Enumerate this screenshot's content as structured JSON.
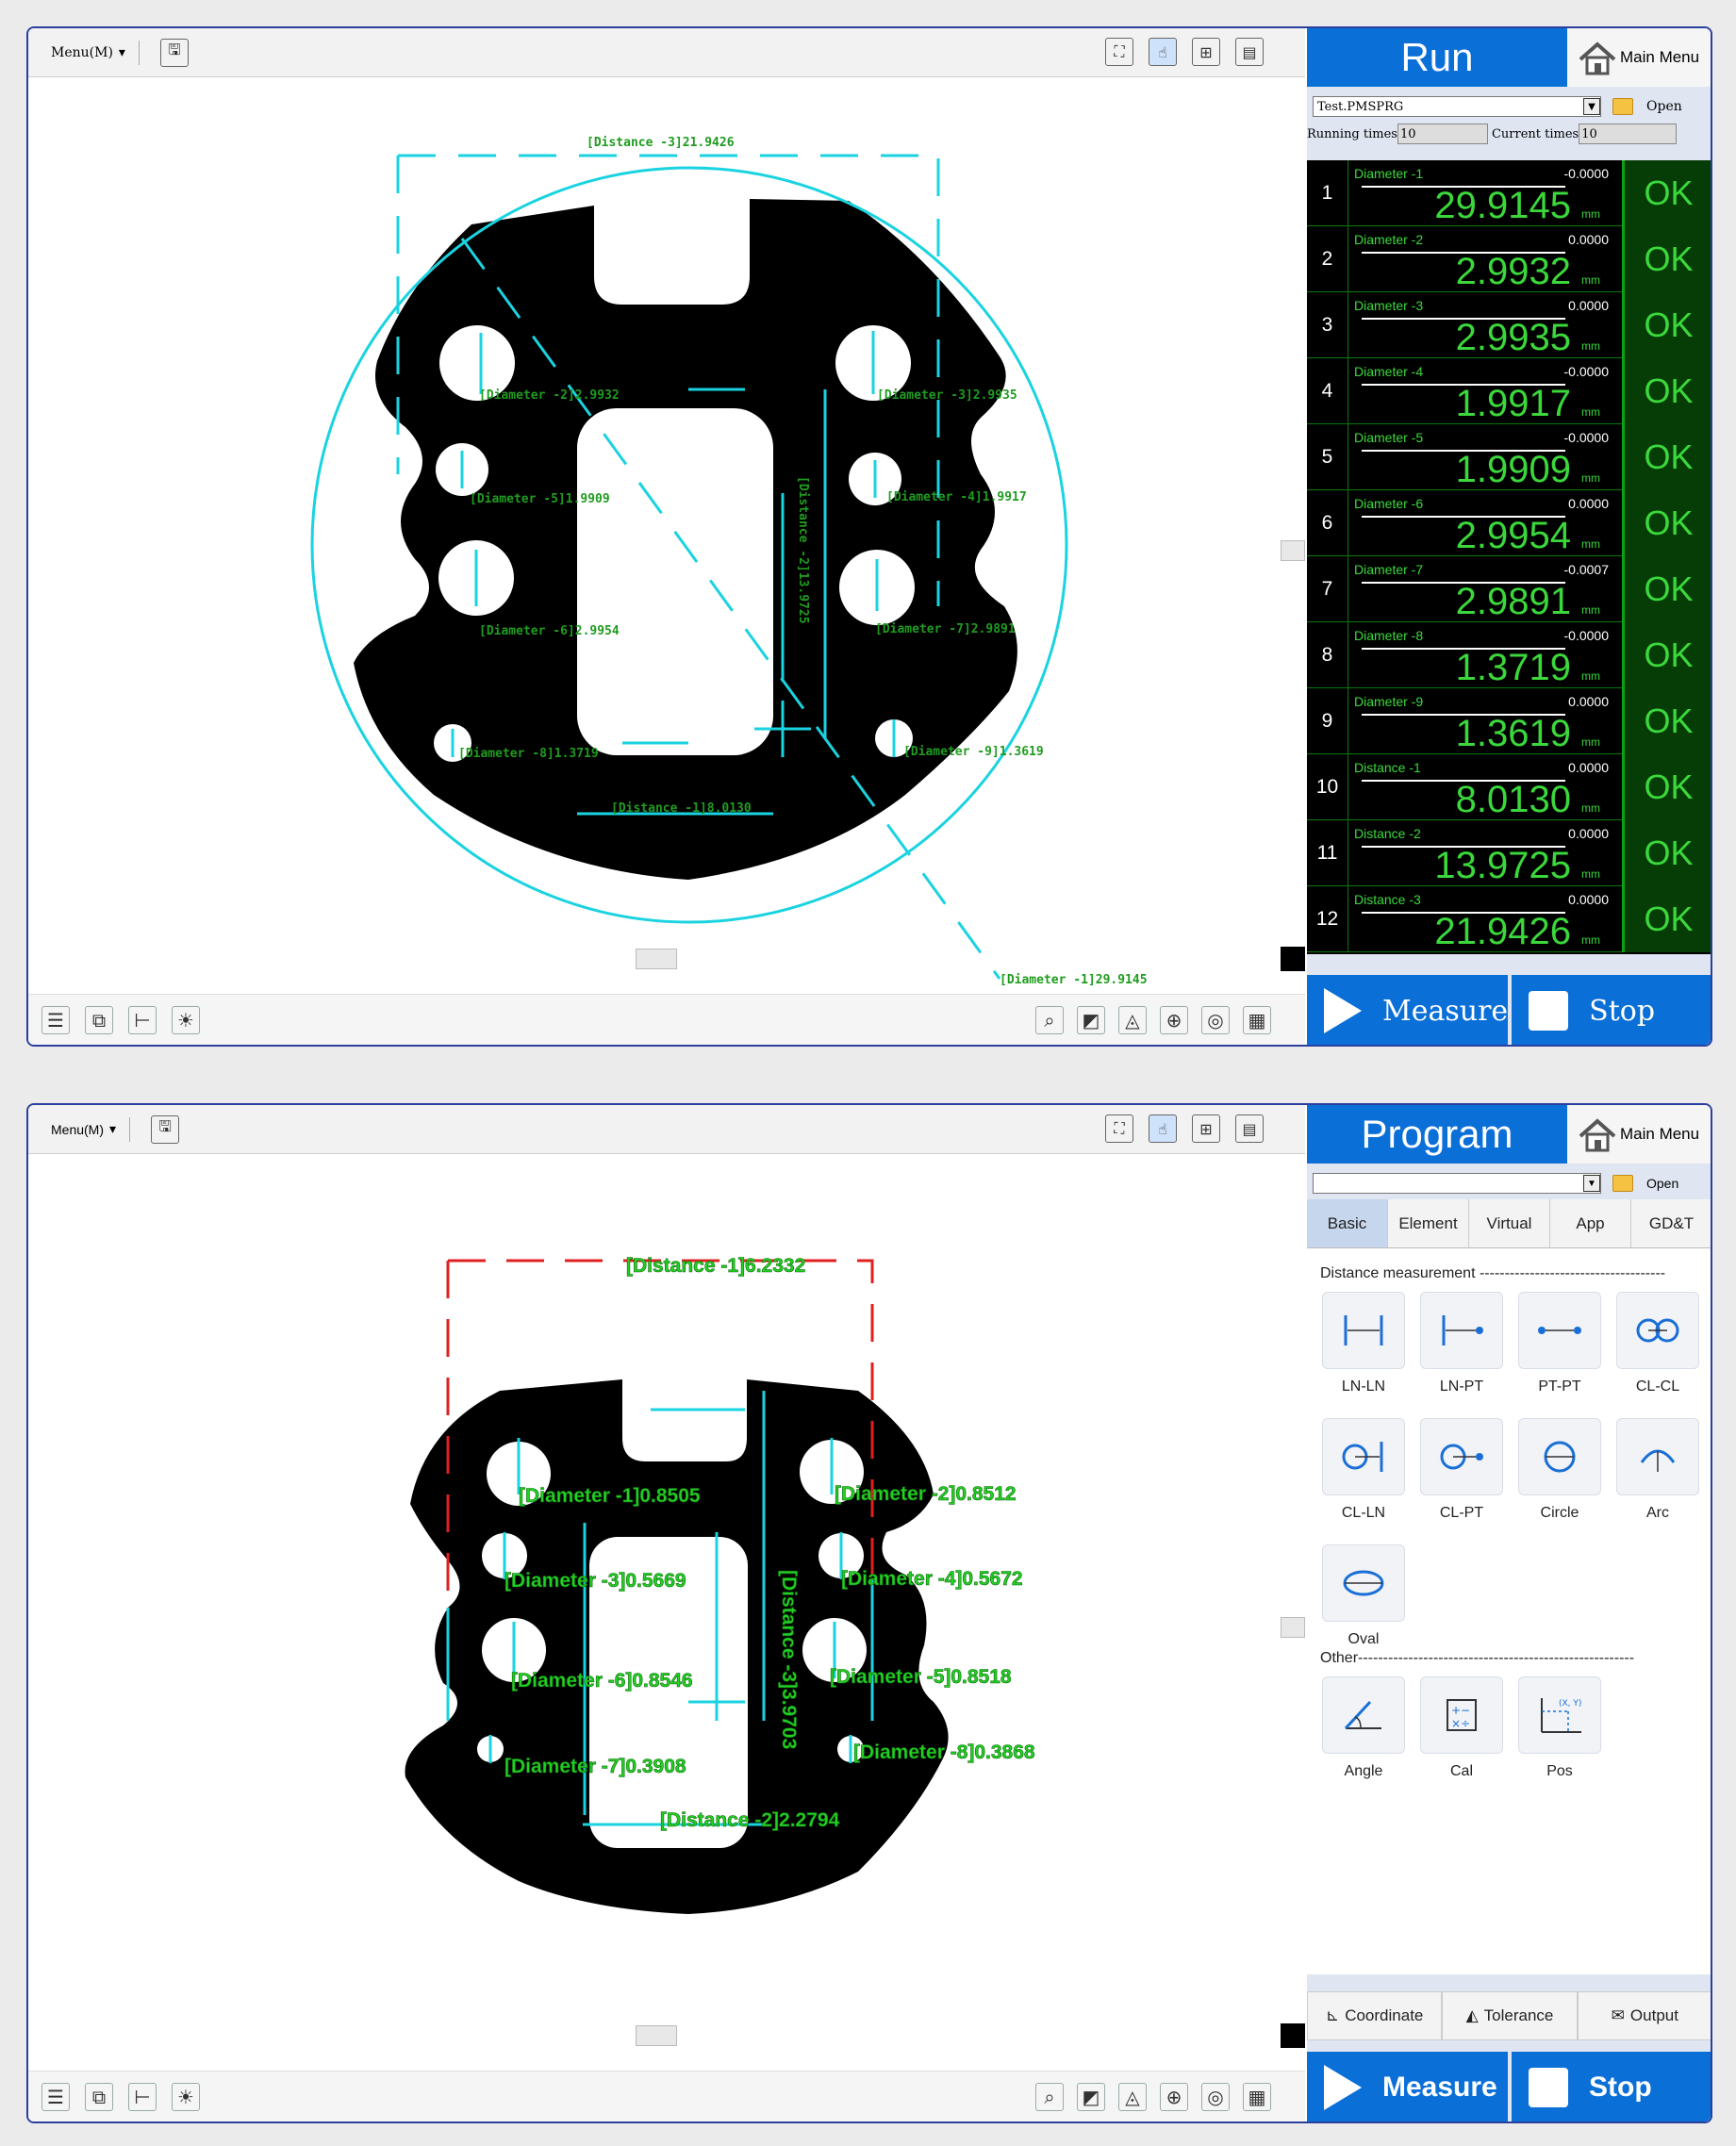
{
  "window1": {
    "menu_label": "Menu(M)",
    "panel_title": "Run",
    "main_menu": "Main Menu",
    "program_file": "Test.PMSPRG",
    "open_label": "Open",
    "running_times_label": "Running times",
    "running_times_value": "10",
    "current_times_label": "Current times",
    "current_times_value": "10",
    "results": [
      {
        "num": "1",
        "name": "Diameter -1",
        "dev": "-0.0000",
        "value": "29.9145",
        "unit": "mm",
        "status": "OK"
      },
      {
        "num": "2",
        "name": "Diameter -2",
        "dev": "0.0000",
        "value": "2.9932",
        "unit": "mm",
        "status": "OK"
      },
      {
        "num": "3",
        "name": "Diameter -3",
        "dev": "0.0000",
        "value": "2.9935",
        "unit": "mm",
        "status": "OK"
      },
      {
        "num": "4",
        "name": "Diameter -4",
        "dev": "-0.0000",
        "value": "1.9917",
        "unit": "mm",
        "status": "OK"
      },
      {
        "num": "5",
        "name": "Diameter -5",
        "dev": "-0.0000",
        "value": "1.9909",
        "unit": "mm",
        "status": "OK"
      },
      {
        "num": "6",
        "name": "Diameter -6",
        "dev": "0.0000",
        "value": "2.9954",
        "unit": "mm",
        "status": "OK"
      },
      {
        "num": "7",
        "name": "Diameter -7",
        "dev": "-0.0007",
        "value": "2.9891",
        "unit": "mm",
        "status": "OK"
      },
      {
        "num": "8",
        "name": "Diameter -8",
        "dev": "-0.0000",
        "value": "1.3719",
        "unit": "mm",
        "status": "OK"
      },
      {
        "num": "9",
        "name": "Diameter -9",
        "dev": "0.0000",
        "value": "1.3619",
        "unit": "mm",
        "status": "OK"
      },
      {
        "num": "10",
        "name": "Distance -1",
        "dev": "0.0000",
        "value": "8.0130",
        "unit": "mm",
        "status": "OK"
      },
      {
        "num": "11",
        "name": "Distance -2",
        "dev": "0.0000",
        "value": "13.9725",
        "unit": "mm",
        "status": "OK"
      },
      {
        "num": "12",
        "name": "Distance -3",
        "dev": "0.0000",
        "value": "21.9426",
        "unit": "mm",
        "status": "OK"
      }
    ],
    "measure_label": "Measure",
    "stop_label": "Stop",
    "annotations": {
      "a1": "[Distance -3]21.9426",
      "a2": "[Diameter -2]2.9932",
      "a3": "[Diameter -3]2.9935",
      "a4": "[Diameter -5]1.9909",
      "a5": "[Diameter -4]1.9917",
      "a6": "[Diameter -6]2.9954",
      "a7": "[Diameter -7]2.9891",
      "a8": "[Diameter -8]1.3719",
      "a9": "[Diameter -9]1.3619",
      "a10": "[Distance -1]8.0130",
      "a11": "[Distance -2]13.9725",
      "a12": "[Diameter -1]29.9145"
    }
  },
  "window2": {
    "menu_label": "Menu(M)",
    "panel_title": "Program",
    "main_menu": "Main Menu",
    "open_label": "Open",
    "tabs": [
      "Basic",
      "Element",
      "Virtual",
      "App",
      "GD&T"
    ],
    "section_distance": "Distance measurement -------------------------------------",
    "tools": [
      "LN-LN",
      "LN-PT",
      "PT-PT",
      "CL-CL",
      "CL-LN",
      "CL-PT",
      "Circle",
      "Arc",
      "Oval"
    ],
    "section_other": "Other-------------------------------------------------------",
    "other_tools": [
      "Angle",
      "Cal",
      "Pos"
    ],
    "pos_icon_text": "(X, Y)",
    "bottom_tabs": [
      "Coordinate",
      "Tolerance",
      "Output"
    ],
    "measure_label": "Measure",
    "stop_label": "Stop",
    "annotations": {
      "b1": "[Distance -1]6.2332",
      "b2": "[Diameter -1]0.8505",
      "b3": "[Diameter -2]0.8512",
      "b4": "[Diameter -3]0.5669",
      "b5": "[Diameter -4]0.5672",
      "b6": "[Diameter -6]0.8546",
      "b7": "[Diameter -5]0.8518",
      "b8": "[Distance -3]3.9703",
      "b9": "[Diameter -7]0.3908",
      "b10": "[Diameter -8]0.3868",
      "b11": "[Distance -2]2.2794"
    }
  },
  "colors": {
    "accent": "#0b6fd8",
    "ok_green": "#3bd83b",
    "overlay_cyan": "#1ad3e0",
    "overlay_red": "#e02020"
  }
}
